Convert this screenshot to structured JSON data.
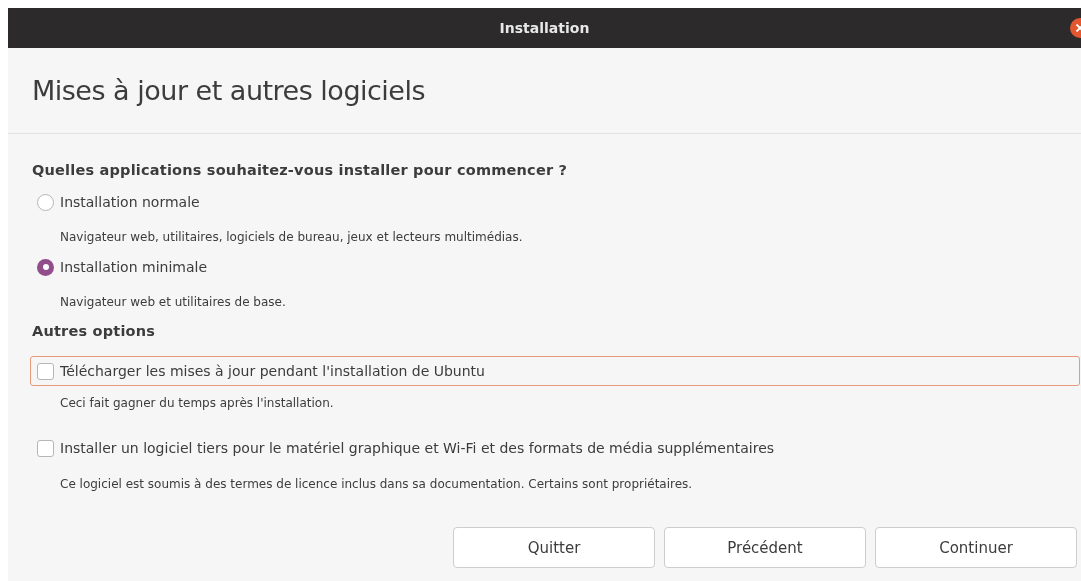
{
  "window": {
    "title": "Installation"
  },
  "heading": "Mises à jour et autres logiciels",
  "install_section": {
    "title": "Quelles applications souhaitez-vous installer pour commencer ?",
    "choices": [
      {
        "label": "Installation normale",
        "description": "Navigateur web, utilitaires, logiciels de bureau, jeux et lecteurs multimédias.",
        "selected": false
      },
      {
        "label": "Installation minimale",
        "description": "Navigateur web et utilitaires de base.",
        "selected": true
      }
    ]
  },
  "other_section": {
    "title": "Autres options",
    "options": [
      {
        "label": "Télécharger les mises à jour pendant l'installation de Ubuntu",
        "description": "Ceci fait gagner du temps après l'installation.",
        "checked": false,
        "focused": true
      },
      {
        "label": "Installer un logiciel tiers pour le matériel graphique et Wi-Fi et des formats de média supplémentaires",
        "description": "Ce logiciel est soumis à des termes de licence inclus dans sa documentation. Certains sont propriétaires.",
        "checked": false,
        "focused": false
      }
    ]
  },
  "buttons": [
    "Quitter",
    "Précédent",
    "Continuer"
  ]
}
